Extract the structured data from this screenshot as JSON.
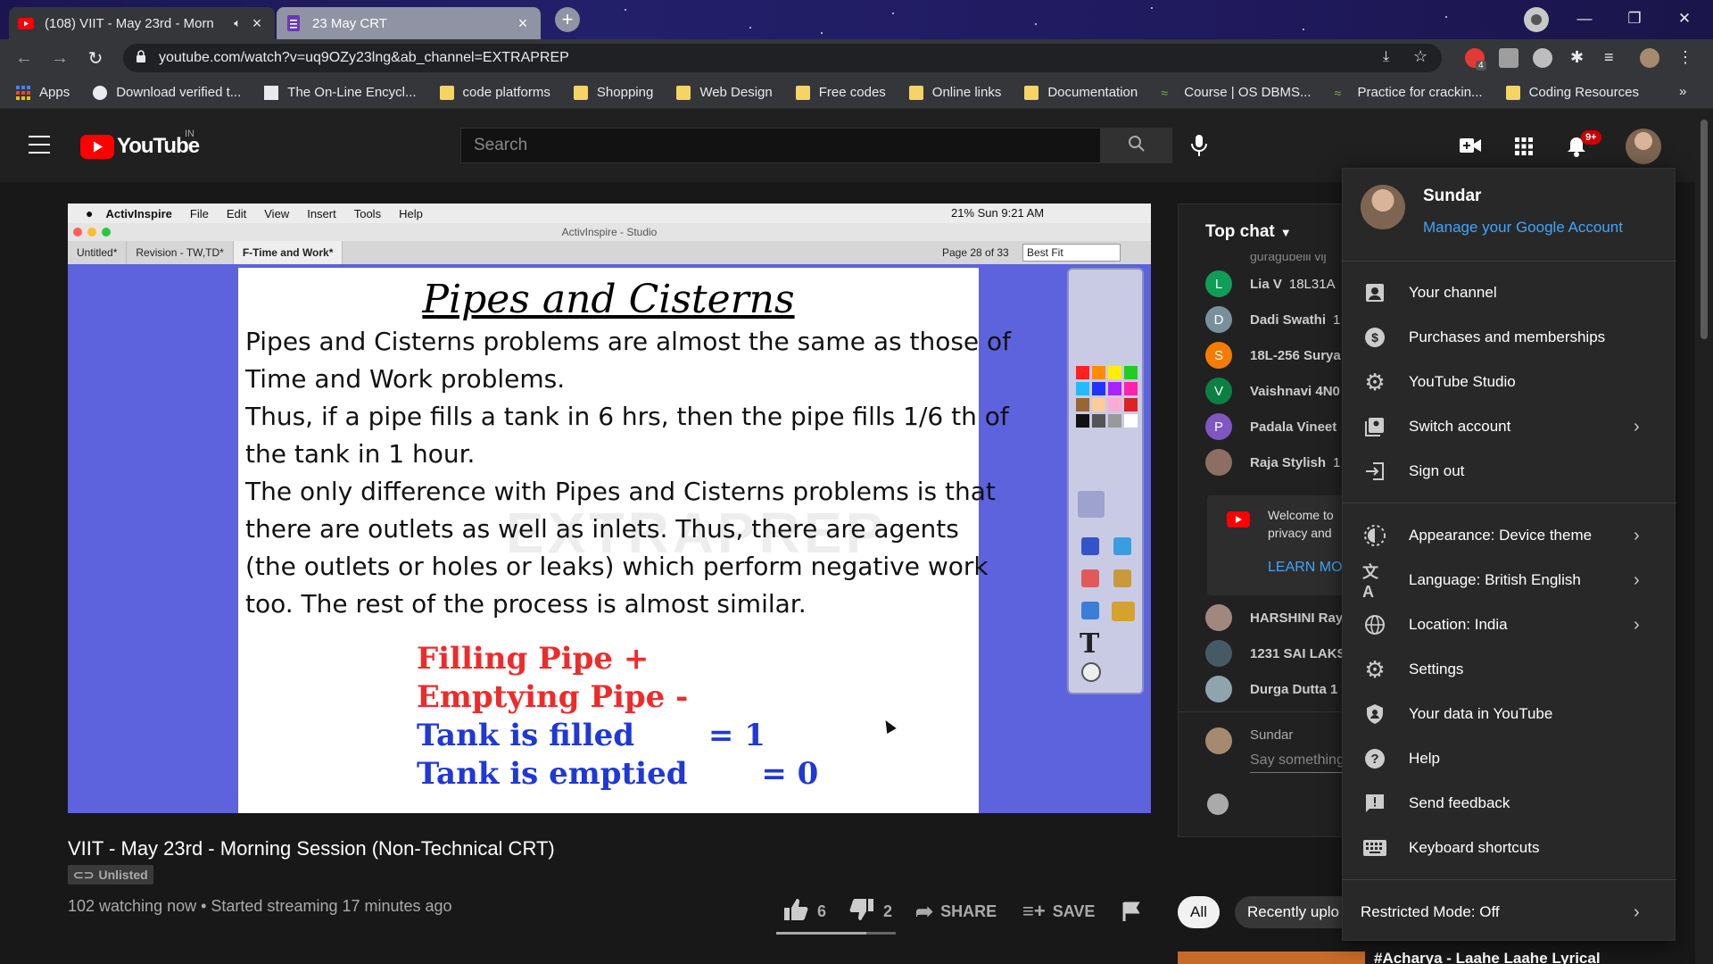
{
  "browser": {
    "tabs": [
      {
        "title": "(108) VIIT - May 23rd - Morn",
        "active": true
      },
      {
        "title": "23 May CRT",
        "active": false
      }
    ],
    "url": "youtube.com/watch?v=uq9OZy23lng&ab_channel=EXTRAPREP",
    "bookmarks": [
      "Apps",
      "Download verified t...",
      "The On-Line Encycl...",
      "code platforms",
      "Shopping",
      "Web Design",
      "Free codes",
      "Online links",
      "Documentation",
      "Course | OS DBMS...",
      "Practice for crackin...",
      "Coding Resources"
    ],
    "bookmarks_more": "»",
    "ext_badge": "4"
  },
  "youtube": {
    "logo_text": "YouTube",
    "country": "IN",
    "search_placeholder": "Search",
    "notif_badge": "9+"
  },
  "video": {
    "mac_menu": [
      "ActivInspire",
      "File",
      "Edit",
      "View",
      "Insert",
      "Tools",
      "Help"
    ],
    "mac_status": "21%  Sun 9:21 AM",
    "app_title": "ActivInspire - Studio",
    "doc_tabs": [
      "Untitled*",
      "Revision - TW,TD*",
      "F-Time and Work*"
    ],
    "page_info": "Page 28 of 33",
    "zoom": "Best Fit",
    "slide": {
      "title": "Pipes and Cisterns",
      "lines": [
        "Pipes and Cisterns problems are almost the same as those of",
        "Time and Work problems.",
        "Thus, if a pipe fills a tank in 6 hrs, then the pipe fills 1/6 th of",
        "the tank in 1 hour.",
        "The only difference with Pipes and Cisterns problems is that",
        "there are outlets as well as inlets. Thus, there are agents",
        "(the outlets or holes or leaks) which perform negative work",
        "too. The rest of the process is almost similar."
      ],
      "red_lines": [
        "Filling Pipe +",
        "Emptying Pipe -"
      ],
      "blue_lines": [
        "Tank is filled       = 1",
        "Tank is emptied       = 0"
      ],
      "watermark": "EXTRAPREP"
    }
  },
  "below": {
    "title": "VIIT - May 23rd - Morning Session (Non-Technical CRT)",
    "unlisted": "Unlisted",
    "watching": "102 watching now • Started streaming 17 minutes ago",
    "likes": "6",
    "dislikes": "2",
    "share": "SHARE",
    "save": "SAVE"
  },
  "chat": {
    "header": "Top chat",
    "partial_top": "guragubelli vij",
    "rows": [
      {
        "initial": "L",
        "name": "Lia V",
        "text": "18L31A",
        "color": "#0f9d58"
      },
      {
        "initial": "D",
        "name": "Dadi Swathi",
        "text": "1",
        "color": "#78909c"
      },
      {
        "initial": "S",
        "name": "18L-256 Surya",
        "text": "",
        "color": "#f57c00"
      },
      {
        "initial": "V",
        "name": "Vaishnavi 4N0",
        "text": "",
        "color": "#0b8043"
      },
      {
        "initial": "P",
        "name": "Padala Vineet",
        "text": "",
        "color": "#7e57c2"
      },
      {
        "initial": "",
        "name": "Raja Stylish",
        "text": "1",
        "color": "#8d6e63"
      }
    ],
    "welcome": "Welcome to",
    "welcome2": "privacy and",
    "learn": "LEARN MO",
    "rows2": [
      {
        "name": "HARSHINI Ray",
        "color": "#a1887f"
      },
      {
        "name": "1231 SAI LAKS",
        "color": "#455a64"
      },
      {
        "name": "Durga Dutta 1",
        "color": "#90a4ae"
      }
    ],
    "me": "Sundar",
    "say": "Say something"
  },
  "chips": [
    "All",
    "Recently uplo"
  ],
  "rec_title": "#Acharya - Laahe Laahe Lyrical",
  "menu": {
    "name": "Sundar",
    "manage": "Manage your Google Account",
    "items1": [
      {
        "label": "Your channel",
        "icon": "person-icon"
      },
      {
        "label": "Purchases and memberships",
        "icon": "dollar-icon"
      },
      {
        "label": "YouTube Studio",
        "icon": "gear-icon"
      },
      {
        "label": "Switch account",
        "icon": "switch-account-icon",
        "arrow": true
      },
      {
        "label": "Sign out",
        "icon": "sign-out-icon"
      }
    ],
    "items2": [
      {
        "label": "Appearance: Device theme",
        "icon": "theme-icon",
        "arrow": true
      },
      {
        "label": "Language: British English",
        "icon": "translate-icon",
        "arrow": true
      },
      {
        "label": "Location: India",
        "icon": "globe-icon",
        "arrow": true
      },
      {
        "label": "Settings",
        "icon": "settings-icon"
      },
      {
        "label": "Your data in YouTube",
        "icon": "shield-icon"
      },
      {
        "label": "Help",
        "icon": "help-icon"
      },
      {
        "label": "Send feedback",
        "icon": "feedback-icon"
      },
      {
        "label": "Keyboard shortcuts",
        "icon": "keyboard-icon"
      }
    ],
    "restricted": "Restricted Mode: Off"
  }
}
